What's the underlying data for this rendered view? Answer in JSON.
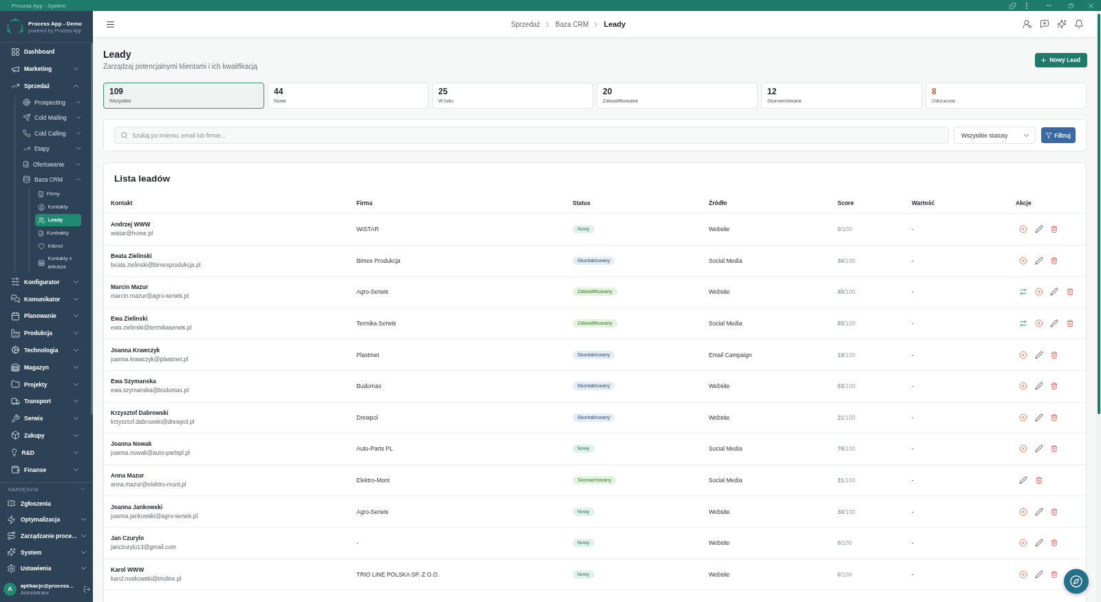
{
  "window": {
    "title": "Process App - System"
  },
  "sidebar": {
    "app_name": "Process App - Demo",
    "app_tagline": "powered by Process App",
    "items": [
      {
        "label": "Dashboard",
        "selected": false
      },
      {
        "label": "Marketing",
        "selected": false,
        "expanded": false
      },
      {
        "label": "Sprzedaż",
        "selected": false,
        "expanded": true,
        "children": [
          {
            "label": "Prospecting",
            "selected": false,
            "expanded": false
          },
          {
            "label": "Cold Mailing",
            "selected": false,
            "expanded": false
          },
          {
            "label": "Cold Calling",
            "selected": false,
            "expanded": false
          },
          {
            "label": "Etapy",
            "selected": false,
            "expanded": false
          },
          {
            "label": "Ofertowanie",
            "selected": false,
            "expanded": false
          },
          {
            "label": "Baza CRM",
            "selected": false,
            "expanded": true,
            "children": [
              {
                "label": "Firmy",
                "selected": false
              },
              {
                "label": "Kontakty",
                "selected": false
              },
              {
                "label": "Leady",
                "selected": true
              },
              {
                "label": "Kontrakty",
                "selected": false
              },
              {
                "label": "Klienci",
                "selected": false
              },
              {
                "label": "Kontakty z arkusza",
                "selected": false
              }
            ]
          }
        ]
      },
      {
        "label": "Konfigurator",
        "selected": false,
        "expanded": false
      },
      {
        "label": "Komunikator",
        "selected": false,
        "expanded": false
      },
      {
        "label": "Planowanie",
        "selected": false,
        "expanded": false
      },
      {
        "label": "Produkcja",
        "selected": false,
        "expanded": false
      },
      {
        "label": "Technologia",
        "selected": false,
        "expanded": false
      },
      {
        "label": "Magazyn",
        "selected": false,
        "expanded": false
      },
      {
        "label": "Projekty",
        "selected": false,
        "expanded": false
      },
      {
        "label": "Transport",
        "selected": false,
        "expanded": false
      },
      {
        "label": "Serwis",
        "selected": false,
        "expanded": false
      },
      {
        "label": "Zakupy",
        "selected": false,
        "expanded": false
      },
      {
        "label": "R&D",
        "selected": false,
        "expanded": false
      },
      {
        "label": "Finanse",
        "selected": false,
        "expanded": false
      }
    ],
    "tools": {
      "heading": "NARZĘDZIA",
      "items": [
        {
          "label": "Zgłoszenia",
          "selected": false
        },
        {
          "label": "Optymalizacja",
          "selected": false,
          "expanded": false
        },
        {
          "label": "Zarządzanie proce...",
          "selected": false,
          "expanded": false
        },
        {
          "label": "System",
          "selected": false,
          "expanded": false
        },
        {
          "label": "Ustawienia",
          "selected": false,
          "expanded": false
        }
      ]
    },
    "user": {
      "initial": "A",
      "name": "aplikacje@process...",
      "role": "Administrator"
    }
  },
  "header": {
    "breadcrumb": [
      {
        "label": "Sprzedaż",
        "current": false
      },
      {
        "label": "Baza CRM",
        "current": false
      },
      {
        "label": "Leady",
        "current": true
      }
    ]
  },
  "page": {
    "title": "Leady",
    "subtitle": "Zarządzaj potencjalnymi klientami i ich kwalifikacją",
    "new_button": "Nowy Lead"
  },
  "stats": [
    {
      "value": "109",
      "label": "Wszystkie",
      "selected": true,
      "color": "#1f2328"
    },
    {
      "value": "44",
      "label": "Nowe",
      "selected": false,
      "color": "#1f2328"
    },
    {
      "value": "25",
      "label": "W toku",
      "selected": false,
      "color": "#1f2328"
    },
    {
      "value": "20",
      "label": "Zakwalifikowane",
      "selected": false,
      "color": "#1f2328"
    },
    {
      "value": "12",
      "label": "Skonwertowane",
      "selected": false,
      "color": "#1f2328"
    },
    {
      "value": "8",
      "label": "Odrzucone",
      "selected": false,
      "color": "#d4583a"
    }
  ],
  "filters": {
    "search": {
      "placeholder": "Szukaj po imieniu, email lub firmie..."
    },
    "status_select": {
      "value": "Wszystkie statusy"
    },
    "button": "Filtruj"
  },
  "table": {
    "title": "Lista leadów",
    "columns": [
      "Kontakt",
      "Firma",
      "Status",
      "Źródło",
      "Score",
      "Wartość",
      "Akcje"
    ],
    "rows": [
      {
        "name": "Andrzej WWW",
        "email": "wistar@home.pl",
        "company": "WISTAR",
        "status": {
          "label": "Nowy",
          "color": "#e1f1eb"
        },
        "source": "Website",
        "score": "**0**/100",
        "value": "-",
        "actions": [
          {
            "kind": "reject"
          },
          {
            "kind": "edit"
          },
          {
            "kind": "delete"
          }
        ]
      },
      {
        "name": "Beata Zielinski",
        "email": "beata.zielinski@bimexprodukcja.pl",
        "company": "Bimex Produkcja",
        "status": {
          "label": "Skontaktowany",
          "color": "#e5ecf5"
        },
        "source": "Social Media",
        "score": "**36**/100",
        "value": "-",
        "actions": [
          {
            "kind": "reject"
          },
          {
            "kind": "edit"
          },
          {
            "kind": "delete"
          }
        ]
      },
      {
        "name": "Marcin Mazur",
        "email": "marcin.mazur@agro-serwis.pl",
        "company": "Agro-Serwis",
        "status": {
          "label": "Zakwalifikowany",
          "color": "#e2f3de"
        },
        "source": "Website",
        "score": "**45**/100",
        "value": "-",
        "actions": [
          {
            "kind": "convert"
          },
          {
            "kind": "reject"
          },
          {
            "kind": "edit"
          },
          {
            "kind": "delete"
          }
        ]
      },
      {
        "name": "Ewa Zielinski",
        "email": "ewa.zielinski@termikaserwis.pl",
        "company": "Termika Serwis",
        "status": {
          "label": "Zakwalifikowany",
          "color": "#e2f3de"
        },
        "source": "Social Media",
        "score": "**85**/100",
        "value": "-",
        "actions": [
          {
            "kind": "convert"
          },
          {
            "kind": "reject"
          },
          {
            "kind": "edit"
          },
          {
            "kind": "delete"
          }
        ]
      },
      {
        "name": "Joanna Krawczyk",
        "email": "joanna.krawczyk@plastmet.pl",
        "company": "Plastmet",
        "status": {
          "label": "Skontaktowany",
          "color": "#e5ecf5"
        },
        "source": "Email Campaign",
        "score": "**19**/100",
        "value": "-",
        "actions": [
          {
            "kind": "reject"
          },
          {
            "kind": "edit"
          },
          {
            "kind": "delete"
          }
        ]
      },
      {
        "name": "Ewa Szymanska",
        "email": "ewa.szymanska@budomax.pl",
        "company": "Budomax",
        "status": {
          "label": "Skontaktowany",
          "color": "#e5ecf5"
        },
        "source": "Website",
        "score": "**53**/100",
        "value": "-",
        "actions": [
          {
            "kind": "reject"
          },
          {
            "kind": "edit"
          },
          {
            "kind": "delete"
          }
        ]
      },
      {
        "name": "Krzysztof Dabrowski",
        "email": "krzysztof.dabrowski@drewpol.pl",
        "company": "Drewpol",
        "status": {
          "label": "Skontaktowany",
          "color": "#e5ecf5"
        },
        "source": "Website",
        "score": "**21**/100",
        "value": "-",
        "actions": [
          {
            "kind": "reject"
          },
          {
            "kind": "edit"
          },
          {
            "kind": "delete"
          }
        ]
      },
      {
        "name": "Joanna Nowak",
        "email": "joanna.nowak@auto-partspl.pl",
        "company": "Auto-Parts PL",
        "status": {
          "label": "Nowy",
          "color": "#e1f1eb"
        },
        "source": "Social Media",
        "score": "**76**/100",
        "value": "-",
        "actions": [
          {
            "kind": "reject"
          },
          {
            "kind": "edit"
          },
          {
            "kind": "delete"
          }
        ]
      },
      {
        "name": "Anna Mazur",
        "email": "anna.mazur@elektro-mont.pl",
        "company": "Elektro-Mont",
        "status": {
          "label": "Skonwertowany",
          "color": "#e2f3de"
        },
        "source": "Social Media",
        "score": "**31**/100",
        "value": "-",
        "actions": [
          {
            "kind": "edit"
          },
          {
            "kind": "delete"
          }
        ]
      },
      {
        "name": "Joanna Jankowski",
        "email": "joanna.jankowski@agro-serwis.pl",
        "company": "Agro-Serwis",
        "status": {
          "label": "Nowy",
          "color": "#e1f1eb"
        },
        "source": "Website",
        "score": "**30**/100",
        "value": "-",
        "actions": [
          {
            "kind": "reject"
          },
          {
            "kind": "edit"
          },
          {
            "kind": "delete"
          }
        ]
      },
      {
        "name": "Jan Czurylo",
        "email": "janczurylo13@gmail.com",
        "company": "-",
        "status": {
          "label": "Nowy",
          "color": "#e1f1eb"
        },
        "source": "Website",
        "score": "**0**/100",
        "value": "-",
        "actions": [
          {
            "kind": "reject"
          },
          {
            "kind": "edit"
          },
          {
            "kind": "delete"
          }
        ]
      },
      {
        "name": "Karol WWW",
        "email": "karol.noskowski@trioline.pl",
        "company": "TRIO LINE POLSKA SP. Z O.O.",
        "status": {
          "label": "Nowy",
          "color": "#e1f1eb"
        },
        "source": "Website",
        "score": "**0**/100",
        "value": "-",
        "actions": [
          {
            "kind": "reject"
          },
          {
            "kind": "edit"
          },
          {
            "kind": "delete"
          }
        ]
      }
    ]
  }
}
